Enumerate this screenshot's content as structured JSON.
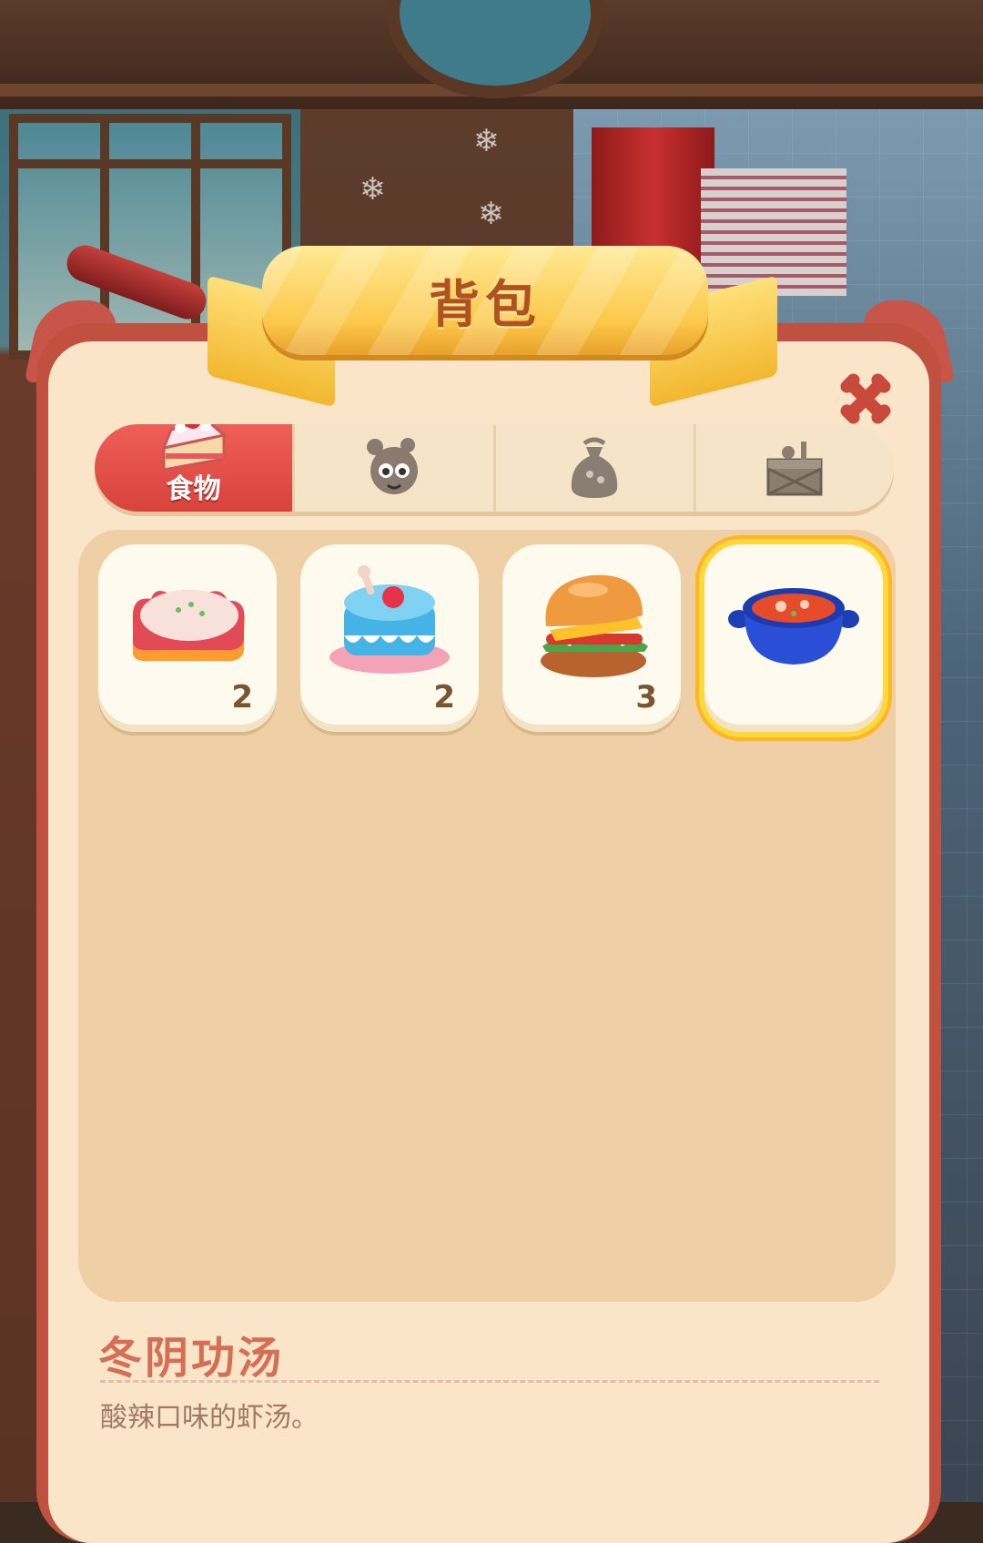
{
  "header": {
    "title": "背包",
    "close_icon": "close-icon"
  },
  "tabs": [
    {
      "label": "食物",
      "icon": "cake-icon",
      "active": true
    },
    {
      "label": "",
      "icon": "toy-icon",
      "active": false
    },
    {
      "label": "",
      "icon": "bag-icon",
      "active": false
    },
    {
      "label": "",
      "icon": "crate-icon",
      "active": false
    }
  ],
  "items": [
    {
      "icon": "cat-cake-icon",
      "count": "2",
      "selected": false
    },
    {
      "icon": "blue-cake-icon",
      "count": "2",
      "selected": false
    },
    {
      "icon": "burger-icon",
      "count": "3",
      "selected": false
    },
    {
      "icon": "soup-pot-icon",
      "count": "",
      "selected": true
    }
  ],
  "detail": {
    "name": "冬阴功汤",
    "description": "酸辣口味的虾汤。"
  },
  "colors": {
    "accent_red": "#d8433c",
    "title_gold": "#fcc84a",
    "panel_bg": "#fae5c9",
    "selected_glow": "#ffd93b"
  }
}
